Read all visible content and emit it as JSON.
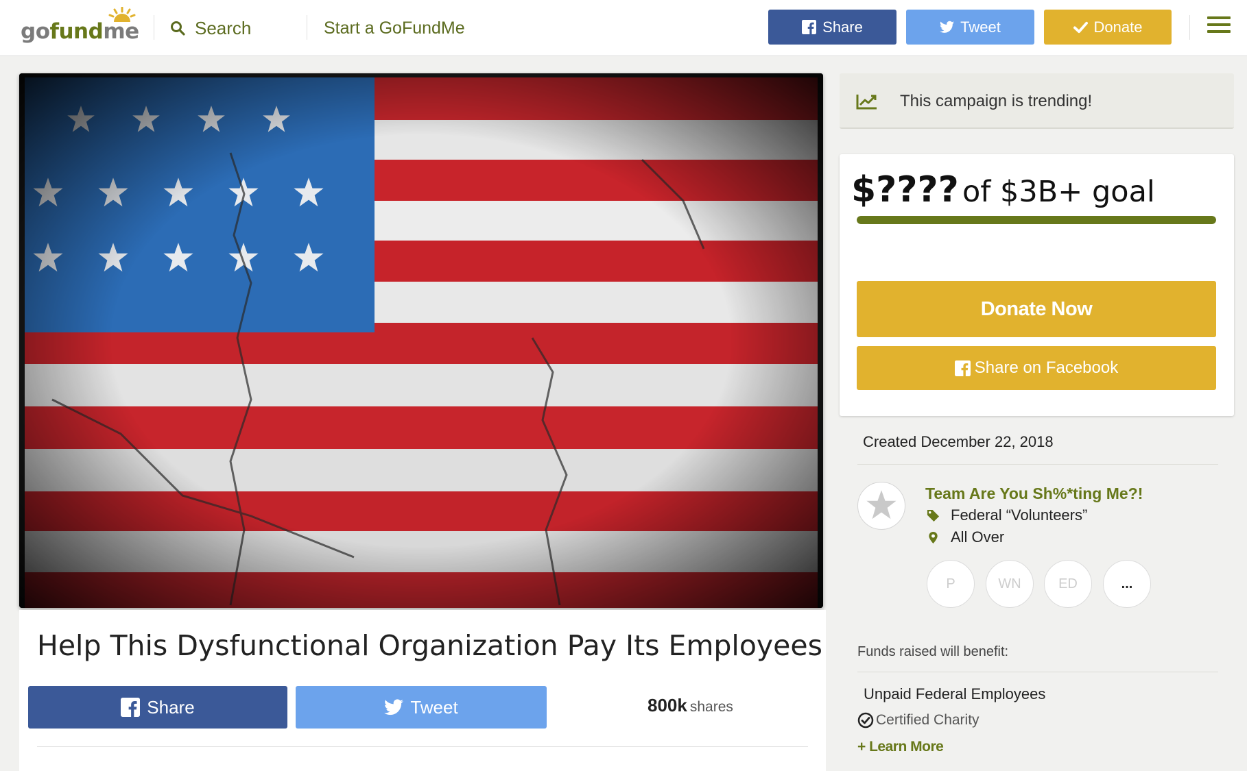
{
  "header": {
    "logo": {
      "go": "go",
      "fund": "fund",
      "me": "me"
    },
    "search_label": "Search",
    "start_label": "Start a GoFundMe",
    "share_label": "Share",
    "tweet_label": "Tweet",
    "donate_label": "Donate",
    "icons": [
      "search-icon",
      "facebook-icon",
      "twitter-icon",
      "check-icon",
      "hamburger-menu-icon"
    ]
  },
  "campaign": {
    "title": "Help This Dysfunctional Organization Pay Its Employees",
    "share_label": "Share",
    "tweet_label": "Tweet",
    "shares_count": "800k",
    "shares_label": "shares"
  },
  "sidebar": {
    "trending": "This campaign is trending!",
    "raised": "$????",
    "goal_text": "of $3B+ goal",
    "progress_fraction": 1.0,
    "donate_now": "Donate Now",
    "share_facebook": "Share on Facebook",
    "created": "Created December 22, 2018",
    "organizer": {
      "name": "Team Are You Sh%*ting Me?!",
      "category": "Federal “Volunteers”",
      "location": "All Over"
    },
    "donors": [
      "P",
      "WN",
      "ED",
      "..."
    ],
    "funds_label": "Funds raised will benefit:",
    "beneficiary": "Unpaid Federal Employees",
    "certified": "Certified Charity",
    "learn_more": "+ Learn More"
  },
  "colors": {
    "brand_green": "#67781a",
    "donate_gold": "#e1b22e",
    "facebook_blue": "#3b5998",
    "twitter_blue": "#6ca3ec"
  }
}
